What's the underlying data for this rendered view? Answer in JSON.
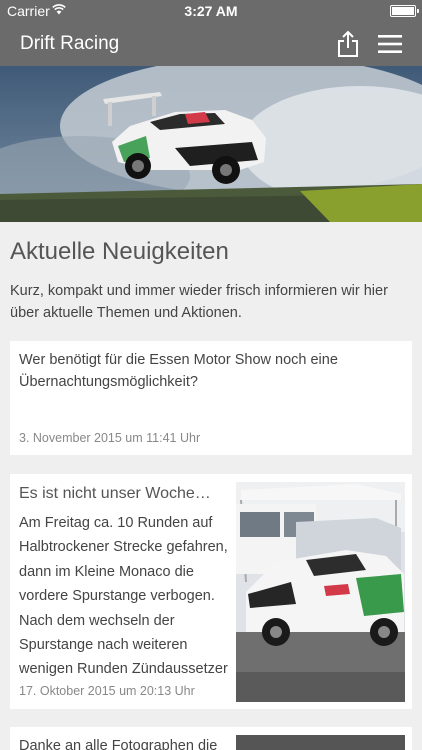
{
  "status_bar": {
    "carrier": "Carrier",
    "time": "3:27 AM"
  },
  "nav": {
    "title": "Drift Racing",
    "share_icon": "share-icon",
    "menu_icon": "hamburger-menu-icon",
    "bar_color": "#6b6b6b"
  },
  "section": {
    "title": "Aktuelle Neuigkeiten",
    "intro": "Kurz, kompakt und immer wieder frisch informieren wir hier über aktuelle Themen und Aktionen."
  },
  "news": [
    {
      "text": "Wer benötigt für die Essen Motor Show noch eine Übernachtungsmöglichkeit?",
      "date": "3. November 2015 um 11:41 Uhr"
    },
    {
      "headline": "Es ist nicht unser Woche…",
      "body": "Am Freitag ca. 10 Runden auf Halbtrockener Strecke gefahren, dann im Kleine Monaco die vordere Spurstange verbogen. Nach dem wechseln der Spurstange nach weiteren wenigen Runden Zündaussetzer",
      "date": "17. Oktober 2015 um 20:13 Uhr"
    },
    {
      "headline": "Danke an alle Fotographen die"
    }
  ]
}
